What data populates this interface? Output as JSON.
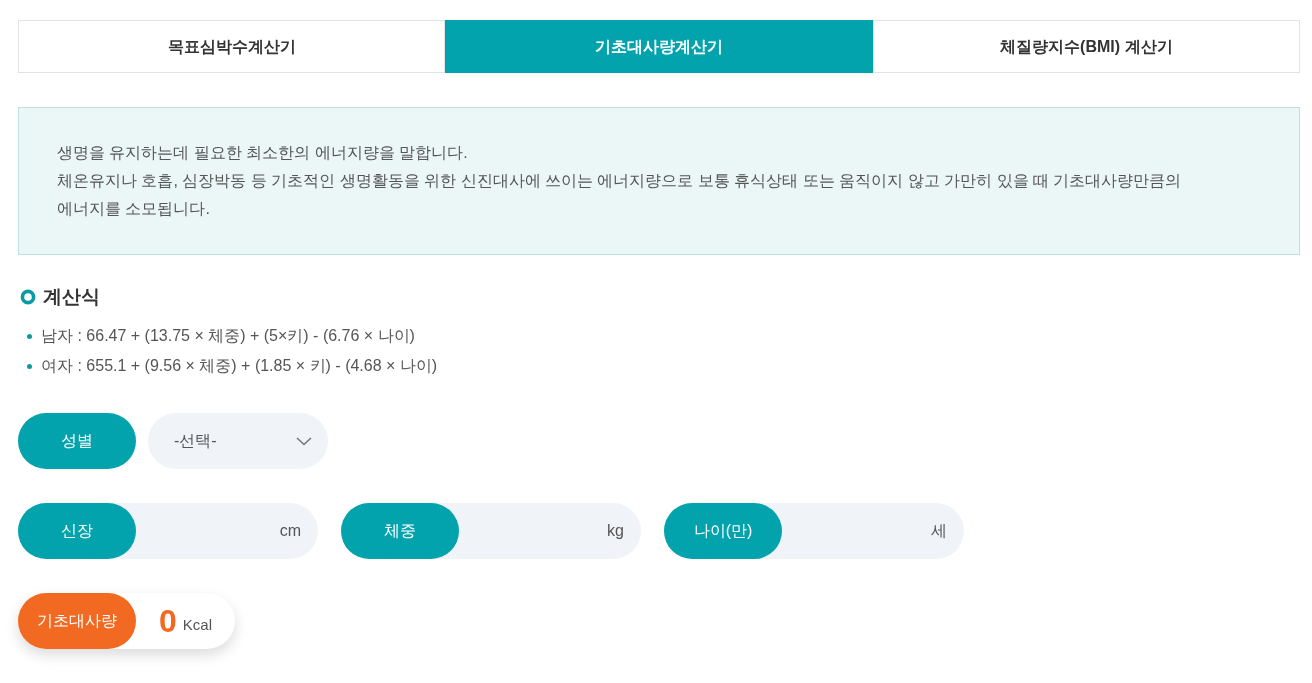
{
  "tabs": [
    {
      "label": "목표심박수계산기",
      "selected": false
    },
    {
      "label": "기초대사량계산기",
      "selected": true
    },
    {
      "label": "체질량지수(BMI) 계산기",
      "selected": false
    }
  ],
  "description": {
    "lines": [
      "생명을 유지하는데 필요한 최소한의 에너지량을 말합니다.",
      "체온유지나 호흡, 심장박동 등 기초적인 생명활동을 위한 신진대사에 쓰이는 에너지량으로 보통 휴식상태 또는 움직이지 않고 가만히 있을 때 기초대사량만큼의 에너지를 소모됩니다."
    ]
  },
  "formula": {
    "title": "계산식",
    "items": [
      "남자 : 66.47 + (13.75 × 체중) + (5×키) - (6.76 × 나이)",
      "여자 : 655.1 + (9.56 × 체중) + (1.85 × 키) - (4.68 × 나이)"
    ]
  },
  "gender": {
    "label": "성별",
    "value": "-선택-"
  },
  "fields": [
    {
      "label": "신장",
      "unit": "cm"
    },
    {
      "label": "체중",
      "unit": "kg"
    },
    {
      "label": "나이(만)",
      "unit": "세"
    }
  ],
  "result": {
    "label": "기초대사량",
    "value": "0",
    "unit": "Kcal"
  }
}
